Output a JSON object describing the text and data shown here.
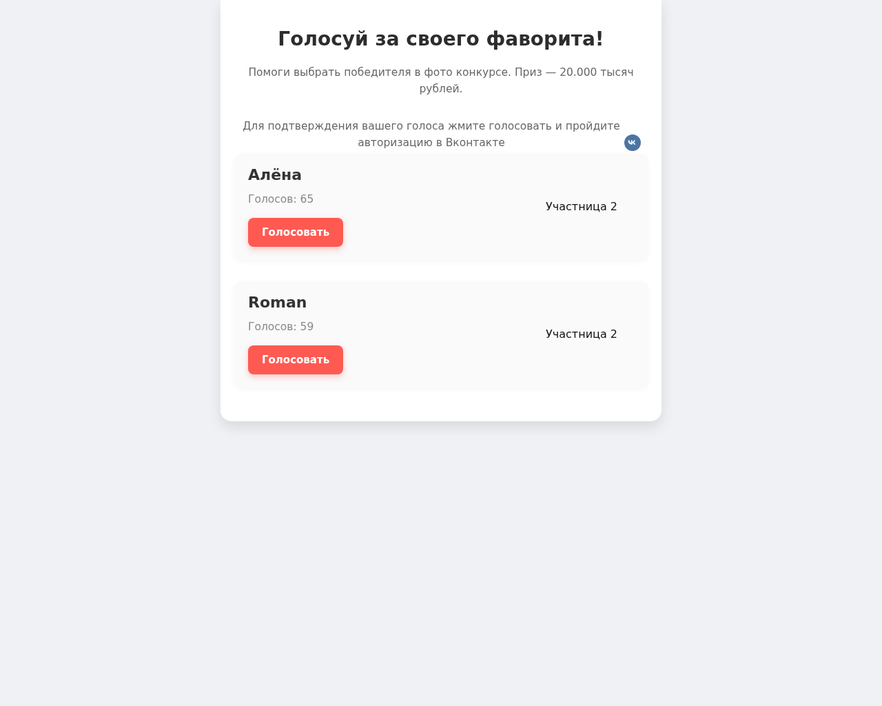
{
  "title": "Голосуй за своего фаворита!",
  "intro": [
    "Помоги выбрать победителя в фото конкурсе. Приз — 20.000 тысяч рублей.",
    "Для подтверждения вашего голоса жмите голосовать и пройдите авторизацию в Вконтакте"
  ],
  "participants": [
    {
      "name": "Алёна",
      "votes": "Голосов: 65",
      "button": "Голосовать",
      "photo_label": "Участница 2"
    },
    {
      "name": "Roman",
      "votes": "Голосов: 59",
      "button": "Голосовать",
      "photo_label": "Участница 2"
    }
  ]
}
